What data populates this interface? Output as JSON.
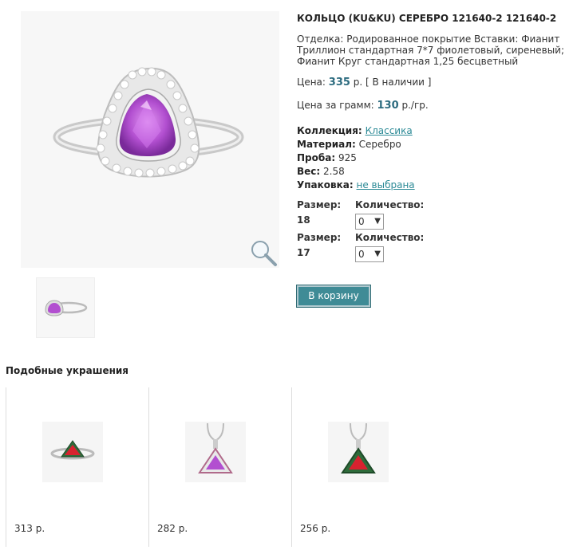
{
  "product": {
    "title": "КОЛЬЦО (KU&KU) СЕРЕБРО 121640-2 121640-2",
    "description": "Отделка: Родированное покрытие Вставки: Фианит Триллион стандартная 7*7 фиолетовый, сиреневый; Фианит Круг стандартная 1,25 бесцветный",
    "price_label": "Цена:",
    "price_value": "335",
    "price_unit": "р.",
    "availability": "[ В наличии ]",
    "gram_label": "Цена за грамм:",
    "gram_value": "130",
    "gram_unit": "р./гр.",
    "collection_label": "Коллекция:",
    "collection_value": "Классика",
    "material_label": "Материал:",
    "material_value": "Серебро",
    "probe_label": "Проба:",
    "probe_value": "925",
    "weight_label": "Вес:",
    "weight_value": "2.58",
    "package_label": "Упаковка:",
    "package_value": "не выбрана"
  },
  "sizes": [
    {
      "size_label": "Размер:",
      "size_value": "18",
      "qty_label": "Количество:",
      "qty_value": "0"
    },
    {
      "size_label": "Размер:",
      "size_value": "17",
      "qty_label": "Количество:",
      "qty_value": "0"
    }
  ],
  "cart_button": "В корзину",
  "similar": {
    "heading": "Подобные украшения",
    "items": [
      {
        "price": "313 р.",
        "icon": "ring-icon"
      },
      {
        "price": "282 р.",
        "icon": "pendant-icon"
      },
      {
        "price": "256 р.",
        "icon": "pendant-icon"
      }
    ]
  },
  "icons": {
    "zoom": "magnifier-icon"
  },
  "colors": {
    "accent": "#3f8b96",
    "price": "#2c6b7f",
    "link": "#2c8a96",
    "gem_main": "#b24fd0"
  }
}
